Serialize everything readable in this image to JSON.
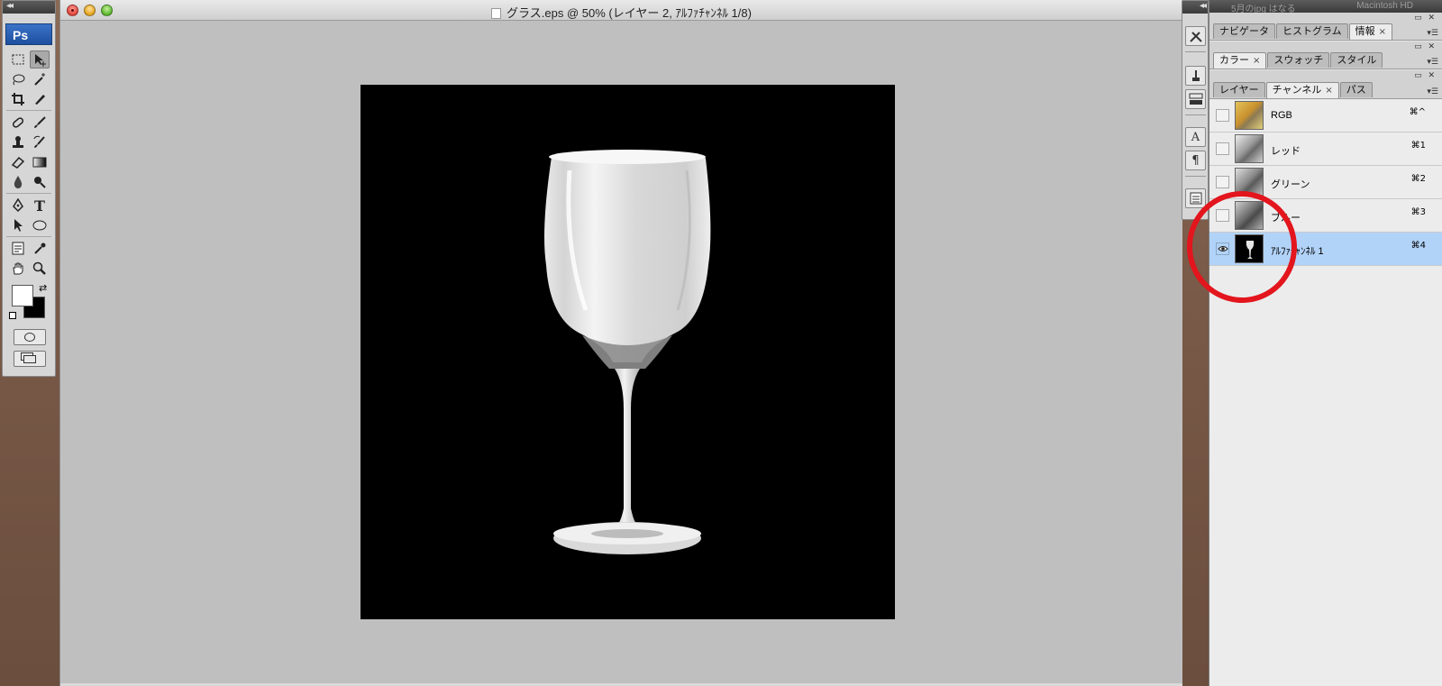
{
  "document": {
    "title": "グラス.eps @ 50% (レイヤー 2, ｱﾙﾌｧﾁｬﾝﾈﾙ 1/8)"
  },
  "tools_panel": {
    "badge": "Ps",
    "tools": [
      "marquee-icon",
      "move-icon",
      "lasso-icon",
      "magic-wand-icon",
      "crop-icon",
      "slice-icon",
      "healing-brush-icon",
      "brush-icon",
      "clone-stamp-icon",
      "history-brush-icon",
      "eraser-icon",
      "gradient-icon",
      "blur-icon",
      "dodge-icon",
      "pen-icon",
      "type-icon",
      "path-select-icon",
      "ellipse-shape-icon",
      "notes-icon",
      "eyedropper-icon",
      "hand-icon",
      "zoom-icon"
    ],
    "type_glyph": "T",
    "foreground_color": "#ffffff",
    "background_color": "#000000"
  },
  "dock": {
    "icons": [
      "tools-preset-icon",
      "brush-preset-icon",
      "layer-comps-icon",
      "character-icon",
      "paragraph-icon",
      "clone-source-icon"
    ],
    "character_glyph": "A",
    "paragraph_glyph": "¶"
  },
  "right_panel": {
    "top_strip": {
      "left": "5月のjpg はなる",
      "right": "Macintosh HD"
    },
    "group1_tabs": [
      {
        "label": "ナビゲータ",
        "active": false,
        "closable": false
      },
      {
        "label": "ヒストグラム",
        "active": false,
        "closable": false
      },
      {
        "label": "情報",
        "active": true,
        "closable": true
      }
    ],
    "group2_tabs": [
      {
        "label": "カラー",
        "active": true,
        "closable": true
      },
      {
        "label": "スウォッチ",
        "active": false,
        "closable": false
      },
      {
        "label": "スタイル",
        "active": false,
        "closable": false
      }
    ],
    "group3_tabs": [
      {
        "label": "レイヤー",
        "active": false,
        "closable": false
      },
      {
        "label": "チャンネル",
        "active": true,
        "closable": true
      },
      {
        "label": "パス",
        "active": false,
        "closable": false
      }
    ],
    "close_glyph": "×",
    "channels": [
      {
        "name": "RGB",
        "shortcut": "⌘^",
        "visible": false,
        "selected": false
      },
      {
        "name": "レッド",
        "shortcut": "⌘1",
        "visible": false,
        "selected": false
      },
      {
        "name": "グリーン",
        "shortcut": "⌘2",
        "visible": false,
        "selected": false
      },
      {
        "name": "ブルー",
        "shortcut": "⌘3",
        "visible": false,
        "selected": false
      },
      {
        "name": "ｱﾙﾌｧﾁｬﾝﾈﾙ 1",
        "shortcut": "⌘4",
        "visible": true,
        "selected": true
      }
    ]
  },
  "annotation": {
    "color": "#e3151d",
    "shape": "circle"
  }
}
